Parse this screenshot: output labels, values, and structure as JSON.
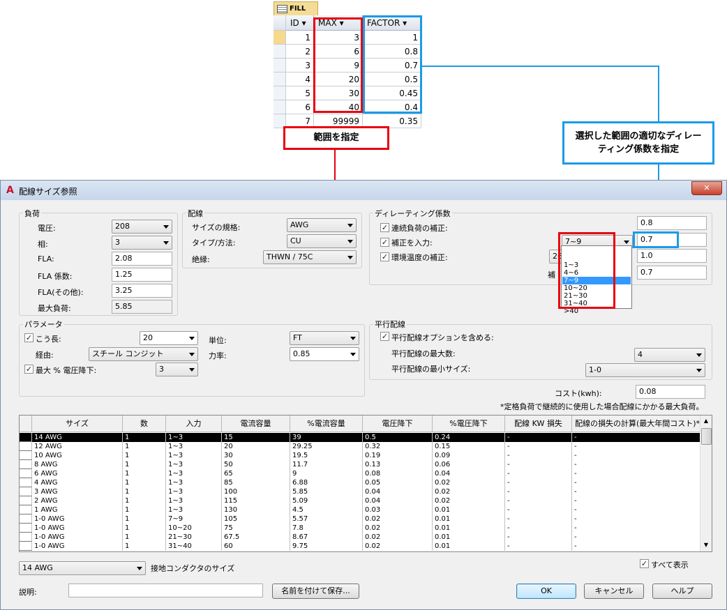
{
  "access_table": {
    "tab_label": "FILL",
    "columns": [
      "ID",
      "MAX",
      "FACTOR"
    ],
    "rows": [
      {
        "id": "1",
        "max": "3",
        "factor": "1"
      },
      {
        "id": "2",
        "max": "6",
        "factor": "0.8"
      },
      {
        "id": "3",
        "max": "9",
        "factor": "0.7"
      },
      {
        "id": "4",
        "max": "20",
        "factor": "0.5"
      },
      {
        "id": "5",
        "max": "30",
        "factor": "0.45"
      },
      {
        "id": "6",
        "max": "40",
        "factor": "0.4"
      },
      {
        "id": "7",
        "max": "99999",
        "factor": "0.35"
      }
    ]
  },
  "callouts": {
    "range": "範囲を指定",
    "factor": "選択した範囲の適切なディレーティング係数を指定"
  },
  "dialog": {
    "title": "配線サイズ参照",
    "close": "✕",
    "load": {
      "legend": "負荷",
      "voltage_label": "電圧:",
      "voltage": "208",
      "phase_label": "相:",
      "phase": "3",
      "fla_label": "FLA:",
      "fla": "2.08",
      "fla_factor_label": "FLA 係数:",
      "fla_factor": "1.25",
      "fla_other_label": "FLA(その他):",
      "fla_other": "3.25",
      "max_load_label": "最大負荷:",
      "max_load": "5.85"
    },
    "wiring": {
      "legend": "配線",
      "size_std_label": "サイズの規格:",
      "size_std": "AWG",
      "type_label": "タイプ/方法:",
      "type": "CU",
      "insulation_label": "絶縁:",
      "insulation": "THWN / 75C"
    },
    "derating": {
      "legend": "ディレーティング係数",
      "continuous_label": "連続負荷の補正:",
      "continuous_value": "0.8",
      "fill_label": "補正を入力:",
      "fill_select": "7~9",
      "fill_value": "0.7",
      "ambient_label": "環境温度の補正:",
      "ambient_select": "26",
      "ambient_value": "1.0",
      "fourth_value": "0.7",
      "dropdown_options": [
        "1~3",
        "4~6",
        "7~9",
        "10~20",
        "21~30",
        "31~40",
        ">40"
      ],
      "dropdown_selected_index": 2,
      "hidden_label_fragment": "補"
    },
    "params": {
      "legend": "パラメータ",
      "length_label": "こう長:",
      "length": "20",
      "route_label": "経由:",
      "route": "スチール コンジット",
      "vdrop_label": "最大 % 電圧降下:",
      "vdrop": "3",
      "unit_label": "単位:",
      "unit": "FT",
      "pf_label": "力率:",
      "pf": "0.85"
    },
    "parallel": {
      "legend": "平行配線",
      "include_label": "平行配線オプションを含める:",
      "max_count_label": "平行配線の最大数:",
      "max_count": "4",
      "min_size_label": "平行配線の最小サイズ:",
      "min_size": "1-0"
    },
    "cost_label": "コスト(kwh):",
    "cost": "0.08",
    "note": "*定格負荷で継続的に使用した場合配線にかかる最大負荷。",
    "grid": {
      "headers": [
        "サイズ",
        "数",
        "入力",
        "電流容量",
        "%電流容量",
        "電圧降下",
        "%電圧降下",
        "配線 KW 損失",
        "配線の損失の計算(最大年間コスト)*"
      ],
      "rows": [
        [
          "14 AWG",
          "1",
          "1~3",
          "15",
          "39",
          "0.5",
          "0.24",
          "-",
          "-"
        ],
        [
          "12 AWG",
          "1",
          "1~3",
          "20",
          "29.25",
          "0.32",
          "0.15",
          "-",
          "-"
        ],
        [
          "10 AWG",
          "1",
          "1~3",
          "30",
          "19.5",
          "0.19",
          "0.09",
          "-",
          "-"
        ],
        [
          "8 AWG",
          "1",
          "1~3",
          "50",
          "11.7",
          "0.13",
          "0.06",
          "-",
          "-"
        ],
        [
          "6 AWG",
          "1",
          "1~3",
          "65",
          "9",
          "0.08",
          "0.04",
          "-",
          "-"
        ],
        [
          "4 AWG",
          "1",
          "1~3",
          "85",
          "6.88",
          "0.05",
          "0.02",
          "-",
          "-"
        ],
        [
          "3 AWG",
          "1",
          "1~3",
          "100",
          "5.85",
          "0.04",
          "0.02",
          "-",
          "-"
        ],
        [
          "2 AWG",
          "1",
          "1~3",
          "115",
          "5.09",
          "0.04",
          "0.02",
          "-",
          "-"
        ],
        [
          "1 AWG",
          "1",
          "1~3",
          "130",
          "4.5",
          "0.03",
          "0.01",
          "-",
          "-"
        ],
        [
          "1-0 AWG",
          "1",
          "7~9",
          "105",
          "5.57",
          "0.02",
          "0.01",
          "-",
          "-"
        ],
        [
          "1-0 AWG",
          "1",
          "10~20",
          "75",
          "7.8",
          "0.02",
          "0.01",
          "-",
          "-"
        ],
        [
          "1-0 AWG",
          "1",
          "21~30",
          "67.5",
          "8.67",
          "0.02",
          "0.01",
          "-",
          "-"
        ],
        [
          "1-0 AWG",
          "1",
          "31~40",
          "60",
          "9.75",
          "0.02",
          "0.01",
          "-",
          "-"
        ]
      ]
    },
    "ground_size": "14 AWG",
    "ground_label": "接地コンダクタのサイズ",
    "show_all_label": "すべて表示",
    "desc_label": "説明:",
    "desc_value": "",
    "save_as": "名前を付けて保存...",
    "ok": "OK",
    "cancel": "キャンセル",
    "help": "ヘルプ"
  },
  "colors": {
    "annotation_red": "#e8000e",
    "annotation_blue": "#1a9be8",
    "highlight": "#3399ff"
  }
}
